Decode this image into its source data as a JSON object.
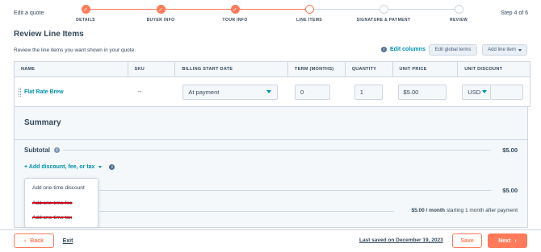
{
  "header": {
    "title": "Edit a quote",
    "step_indicator": "Step 4 of 6",
    "steps": [
      {
        "label": "DETAILS",
        "state": "done"
      },
      {
        "label": "BUYER INFO",
        "state": "done"
      },
      {
        "label": "YOUR INFO",
        "state": "done"
      },
      {
        "label": "LINE ITEMS",
        "state": "current"
      },
      {
        "label": "SIGNATURE & PAYMENT",
        "state": "todo"
      },
      {
        "label": "REVIEW",
        "state": "todo"
      }
    ],
    "check_glyph": "✓"
  },
  "section": {
    "title": "Review Line Items",
    "description": "Review the line items you want shown in your quote.",
    "edit_columns_label": "Edit columns",
    "edit_global_terms_label": "Edit global terms",
    "add_line_item_label": "Add line item"
  },
  "table": {
    "columns": [
      "NAME",
      "SKU",
      "BILLING START DATE",
      "TERM (MONTHS)",
      "QUANTITY",
      "UNIT PRICE",
      "UNIT DISCOUNT"
    ],
    "row": {
      "name": "Flat Rate Brew",
      "sku": "--",
      "billing_start": "At payment",
      "term": "0",
      "quantity": "1",
      "unit_price": "$5.00",
      "currency": "USD"
    }
  },
  "summary": {
    "title": "Summary",
    "subtotal_label": "Subtotal",
    "subtotal_value": "$5.00",
    "add_discount_label": "+ Add discount, fee, or tax",
    "total_value": "$5.00",
    "recurring_amount": "$5.00 / month",
    "recurring_text": "starting 1 month after payment"
  },
  "dropdown": {
    "items": [
      {
        "label": "Add one-time discount",
        "struck": false
      },
      {
        "label": "Add one-time fee",
        "struck": true
      },
      {
        "label": "Add one-time tax",
        "struck": true
      }
    ]
  },
  "footer": {
    "back_label": "Back",
    "exit_label": "Exit",
    "last_saved": "Last saved on December 19, 2023",
    "save_label": "Save",
    "next_label": "Next"
  },
  "colors": {
    "accent": "#ff7a59",
    "link": "#0091ae",
    "text": "#33475b",
    "border": "#cbd6e2",
    "panel_bg": "#f5f8fa",
    "strike": "#d0021b"
  }
}
